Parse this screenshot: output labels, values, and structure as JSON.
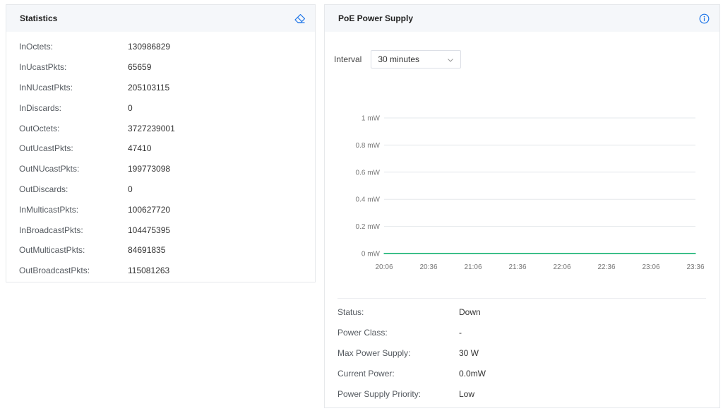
{
  "statistics": {
    "title": "Statistics",
    "clear_icon": "eraser-icon",
    "rows": [
      {
        "label": "InOctets:",
        "value": "130986829"
      },
      {
        "label": "InUcastPkts:",
        "value": "65659"
      },
      {
        "label": "InNUcastPkts:",
        "value": "205103115"
      },
      {
        "label": "InDiscards:",
        "value": "0"
      },
      {
        "label": "OutOctets:",
        "value": "3727239001"
      },
      {
        "label": "OutUcastPkts:",
        "value": "47410"
      },
      {
        "label": "OutNUcastPkts:",
        "value": "199773098"
      },
      {
        "label": "OutDiscards:",
        "value": "0"
      },
      {
        "label": "InMulticastPkts:",
        "value": "100627720"
      },
      {
        "label": "InBroadcastPkts:",
        "value": "104475395"
      },
      {
        "label": "OutMulticastPkts:",
        "value": "84691835"
      },
      {
        "label": "OutBroadcastPkts:",
        "value": "115081263"
      }
    ]
  },
  "poe": {
    "title": "PoE Power Supply",
    "info_icon": "info-circle-icon",
    "interval_label": "Interval",
    "interval_value": "30 minutes",
    "interval_icon": "chevron-down-icon",
    "info_rows": [
      {
        "label": "Status:",
        "value": "Down"
      },
      {
        "label": "Power Class:",
        "value": "-"
      },
      {
        "label": "Max Power Supply:",
        "value": "30 W"
      },
      {
        "label": "Current Power:",
        "value": "0.0mW"
      },
      {
        "label": "Power Supply Priority:",
        "value": "Low"
      }
    ]
  },
  "colors": {
    "accent": "#1a73e8",
    "series": "#3cbf8a",
    "grid": "#e5e8ec"
  },
  "chart_data": {
    "type": "line",
    "title": "",
    "xlabel": "",
    "ylabel": "",
    "x": [
      "20:06",
      "20:36",
      "21:06",
      "21:36",
      "22:06",
      "22:36",
      "23:06",
      "23:36"
    ],
    "y_ticks": [
      "0 mW",
      "0.2 mW",
      "0.4 mW",
      "0.6 mW",
      "0.8 mW",
      "1 mW"
    ],
    "ylim": [
      0,
      1
    ],
    "y_unit": "mW",
    "grid": true,
    "series": [
      {
        "values": [
          0,
          0,
          0,
          0,
          0,
          0,
          0,
          0
        ]
      }
    ]
  }
}
